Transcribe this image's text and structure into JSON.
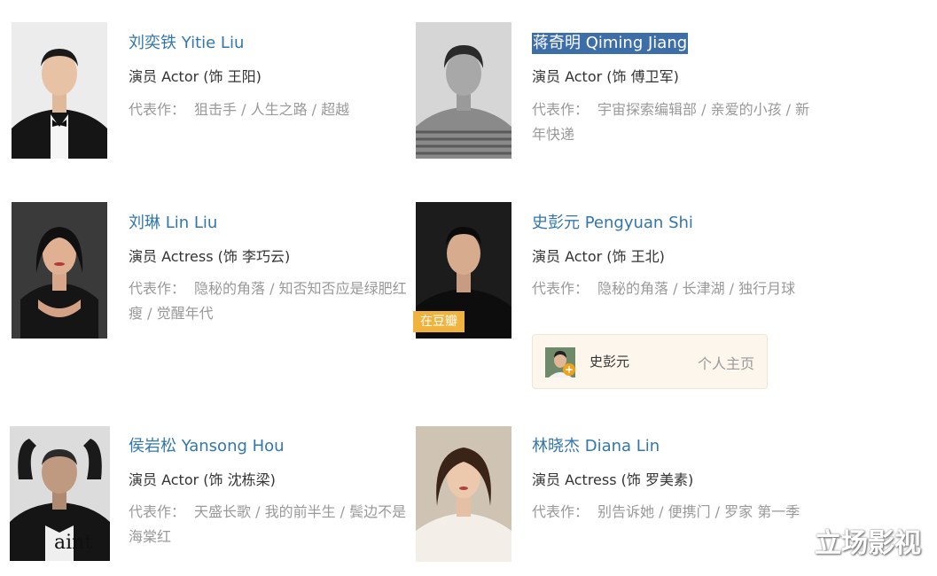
{
  "works_label": "代表作：",
  "cast": [
    {
      "name": "刘奕铁 Yitie Liu",
      "role": "演员 Actor (饰 王阳)",
      "works": "狙击手 / 人生之路 / 超越"
    },
    {
      "name": "蒋奇明 Qiming Jiang",
      "role": "演员 Actor (饰 傅卫军)",
      "works": "宇宙探索编辑部 / 亲爱的小孩 / 新年快递",
      "selected": true
    },
    {
      "name": "刘琳 Lin Liu",
      "role": "演员 Actress (饰 李巧云)",
      "works": "隐秘的角落 / 知否知否应是绿肥红瘦 / 觉醒年代"
    },
    {
      "name": "史彭元 Pengyuan Shi",
      "role": "演员 Actor (饰 王北)",
      "works": "隐秘的角落 / 长津湖 / 独行月球",
      "badge": "在豆瓣",
      "profile": {
        "name": "史彭元",
        "link": "个人主页"
      }
    },
    {
      "name": "侯岩松 Yansong Hou",
      "role": "演员 Actor (饰 沈栋梁)",
      "works": "天盛长歌 / 我的前半生 / 鬓边不是海棠红"
    },
    {
      "name": "林晓杰 Diana Lin",
      "role": "演员 Actress (饰 罗美素)",
      "works": "别告诉她 / 便携门 / 罗家 第一季"
    }
  ],
  "watermark": "立场影视"
}
